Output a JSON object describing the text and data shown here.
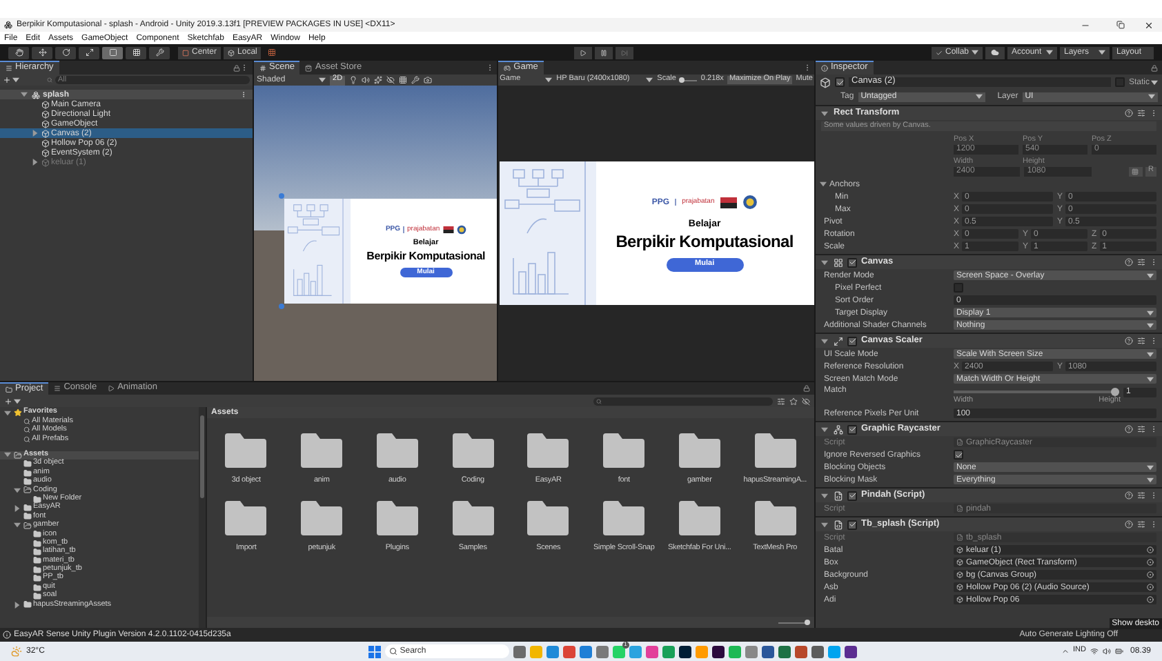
{
  "title_bar": {
    "title": "Berpikir Komputasional - splash - Android - Unity 2019.3.13f1 [PREVIEW PACKAGES IN USE] <DX11>"
  },
  "menu": [
    "File",
    "Edit",
    "Assets",
    "GameObject",
    "Component",
    "Sketchfab",
    "EasyAR",
    "Window",
    "Help"
  ],
  "toolbar": {
    "tools": [
      {
        "kind": "hand",
        "selected": false
      },
      {
        "kind": "move",
        "selected": false
      },
      {
        "kind": "rotate",
        "selected": false
      },
      {
        "kind": "scale",
        "selected": false
      },
      {
        "kind": "rect",
        "selected": true
      },
      {
        "kind": "transform",
        "selected": false
      },
      {
        "kind": "custom",
        "selected": false
      }
    ],
    "pivot": "Center",
    "space": "Local",
    "collab": "Collab",
    "account": "Account",
    "layers": "Layers",
    "layout": "Layout"
  },
  "hierarchy": {
    "title": "Hierarchy",
    "search_placeholder": "All",
    "scene": "splash",
    "items": [
      {
        "label": "Main Camera",
        "selected": false,
        "active": true
      },
      {
        "label": "Directional Light",
        "selected": false,
        "active": true
      },
      {
        "label": "GameObject",
        "selected": false,
        "active": true
      },
      {
        "label": "Canvas (2)",
        "expanded": false,
        "selected": true,
        "active": true
      },
      {
        "label": "Hollow Pop 06 (2)",
        "selected": false,
        "active": true
      },
      {
        "label": "EventSystem (2)",
        "selected": false,
        "active": true
      },
      {
        "label": "keluar (1)",
        "expanded": false,
        "selected": false,
        "active": false
      }
    ]
  },
  "scene_view": {
    "tabs": [
      {
        "label": "Scene",
        "selected": true
      },
      {
        "label": "Asset Store",
        "selected": false
      }
    ],
    "shading": "Shaded",
    "mode_2d": {
      "label": "2D",
      "on": true
    },
    "card": {
      "brand": "PPG",
      "partner": "prajabatan",
      "subtitle": "Belajar",
      "title": "Berpikir Komputasional",
      "button": "Mulai"
    }
  },
  "game_view": {
    "tab": "Game",
    "display": "Game",
    "resolution": "HP Baru (2400x1080)",
    "scale_label": "Scale",
    "scale_slider": {
      "level": 0.1
    },
    "scale": "0.218x",
    "maximize": "Maximize On Play",
    "mute": "Mute",
    "card": {
      "brand": "PPG",
      "partner": "prajabatan",
      "subtitle": "Belajar",
      "title": "Berpikir Komputasional",
      "button": "Mulai"
    }
  },
  "inspector": {
    "title": "Inspector",
    "object": {
      "name": "Canvas (2)",
      "active": true,
      "static": {
        "label": "Static",
        "checked": false
      },
      "tag_label": "Tag",
      "tag": "Untagged",
      "layer_label": "Layer",
      "layer": "UI"
    },
    "rect_transform": {
      "title": "Rect Transform",
      "note": "Some values driven by Canvas.",
      "labels1": [
        "Pos X",
        "Pos Y",
        "Pos Z"
      ],
      "values1": [
        "1200",
        "540",
        "0"
      ],
      "labels2": [
        "Width",
        "Height"
      ],
      "values2": [
        "2400",
        "1080"
      ],
      "raw_button": "R",
      "anchors": {
        "label": "Anchors",
        "expanded": true
      },
      "rows": [
        {
          "kind": "vector",
          "label": "Min",
          "indented": true,
          "cells": [
            {
              "axis": "X",
              "value": "0"
            },
            {
              "axis": "Y",
              "value": "0"
            }
          ]
        },
        {
          "kind": "vector",
          "label": "Max",
          "indented": true,
          "cells": [
            {
              "axis": "X",
              "value": "0"
            },
            {
              "axis": "Y",
              "value": "0"
            }
          ]
        },
        {
          "kind": "vector",
          "label": "Pivot",
          "indented": false,
          "cells": [
            {
              "axis": "X",
              "value": "0.5"
            },
            {
              "axis": "Y",
              "value": "0.5"
            }
          ]
        },
        {
          "kind": "vector",
          "label": "Rotation",
          "indented": false,
          "cells": [
            {
              "axis": "X",
              "value": "0"
            },
            {
              "axis": "Y",
              "value": "0"
            },
            {
              "axis": "Z",
              "value": "0"
            }
          ]
        },
        {
          "kind": "vector",
          "label": "Scale",
          "indented": false,
          "cells": [
            {
              "axis": "X",
              "value": "1"
            },
            {
              "axis": "Y",
              "value": "1"
            },
            {
              "axis": "Z",
              "value": "1"
            }
          ]
        }
      ]
    },
    "components": [
      {
        "title": "Canvas",
        "kind": "canvas",
        "enabled": true,
        "rows": [
          {
            "kind": "dropdown",
            "label": "Render Mode",
            "indented": false,
            "value": "Screen Space - Overlay"
          },
          {
            "kind": "checkbox",
            "label": "Pixel Perfect",
            "indented": true,
            "checked": false
          },
          {
            "kind": "text",
            "label": "Sort Order",
            "indented": true,
            "value": "0"
          },
          {
            "kind": "dropdown",
            "label": "Target Display",
            "indented": true,
            "value": "Display 1"
          },
          {
            "kind": "dropdown",
            "label": "Additional Shader Channels",
            "indented": false,
            "value": "Nothing"
          }
        ]
      },
      {
        "title": "Canvas Scaler",
        "kind": "scaler",
        "enabled": true,
        "rows": [
          {
            "kind": "dropdown",
            "label": "UI Scale Mode",
            "indented": false,
            "value": "Scale With Screen Size"
          },
          {
            "kind": "vector",
            "label": "Reference Resolution",
            "indented": false,
            "cells": [
              {
                "axis": "X",
                "value": "2400"
              },
              {
                "axis": "Y",
                "value": "1080"
              }
            ]
          },
          {
            "kind": "dropdown",
            "label": "Screen Match Mode",
            "indented": false,
            "value": "Match Width Or Height"
          },
          {
            "kind": "slider",
            "label": "Match",
            "indented": false,
            "level": 1,
            "value": "1",
            "min_label": "Width",
            "max_label": "Height"
          },
          {
            "kind": "text",
            "label": "Reference Pixels Per Unit",
            "indented": false,
            "value": "100"
          }
        ]
      },
      {
        "title": "Graphic Raycaster",
        "kind": "raycaster",
        "enabled": true,
        "rows": [
          {
            "kind": "script",
            "label": "Script",
            "indented": false,
            "value": "GraphicRaycaster"
          },
          {
            "kind": "checkbox",
            "label": "Ignore Reversed Graphics",
            "indented": false,
            "checked": true
          },
          {
            "kind": "dropdown",
            "label": "Blocking Objects",
            "indented": false,
            "value": "None"
          },
          {
            "kind": "dropdown",
            "label": "Blocking Mask",
            "indented": false,
            "value": "Everything"
          }
        ]
      },
      {
        "title": "Pindah (Script)",
        "kind": "script",
        "enabled": true,
        "rows": [
          {
            "kind": "script",
            "label": "Script",
            "indented": false,
            "value": "pindah"
          }
        ]
      },
      {
        "title": "Tb_splash (Script)",
        "kind": "script",
        "enabled": true,
        "rows": [
          {
            "kind": "script",
            "label": "Script",
            "indented": false,
            "value": "tb_splash"
          },
          {
            "kind": "object",
            "label": "Batal",
            "indented": false,
            "value": "keluar (1)"
          },
          {
            "kind": "object",
            "label": "Box",
            "indented": false,
            "value": "GameObject (Rect Transform)"
          },
          {
            "kind": "object",
            "label": "Background",
            "indented": false,
            "value": "bg (Canvas Group)"
          },
          {
            "kind": "object",
            "label": "Asb",
            "indented": false,
            "value": "Hollow Pop 06 (2) (Audio Source)"
          },
          {
            "kind": "object",
            "label": "Adi",
            "indented": false,
            "value": "Hollow Pop 06"
          }
        ]
      }
    ]
  },
  "project": {
    "tabs": [
      {
        "label": "Project",
        "selected": true
      },
      {
        "label": "Console",
        "selected": false
      },
      {
        "label": "Animation",
        "selected": false
      }
    ],
    "tree": [
      {
        "label": "Favorites",
        "kind": "favorites",
        "expanded": true,
        "selected": false,
        "children": [
          {
            "label": "All Materials",
            "kind": "search",
            "selected": false
          },
          {
            "label": "All Models",
            "kind": "search",
            "selected": false
          },
          {
            "label": "All Prefabs",
            "kind": "search",
            "selected": false
          }
        ]
      },
      {
        "label": "Assets",
        "kind": "folder",
        "expanded": true,
        "selected": true,
        "children": [
          {
            "label": "3d object",
            "kind": "folder",
            "selected": false
          },
          {
            "label": "anim",
            "kind": "folder",
            "selected": false
          },
          {
            "label": "audio",
            "kind": "folder",
            "selected": false
          },
          {
            "label": "Coding",
            "kind": "folder",
            "expanded": true,
            "selected": false,
            "children": [
              {
                "label": "New Folder",
                "kind": "folder",
                "selected": false
              }
            ]
          },
          {
            "label": "EasyAR",
            "kind": "folder",
            "expanded": false,
            "selected": false
          },
          {
            "label": "font",
            "kind": "folder",
            "selected": false
          },
          {
            "label": "gamber",
            "kind": "folder",
            "expanded": true,
            "selected": false,
            "children": [
              {
                "label": "icon",
                "kind": "folder",
                "selected": false
              },
              {
                "label": "kom_tb",
                "kind": "folder",
                "selected": false
              },
              {
                "label": "latihan_tb",
                "kind": "folder",
                "selected": false
              },
              {
                "label": "materi_tb",
                "kind": "folder",
                "selected": false
              },
              {
                "label": "petunjuk_tb",
                "kind": "folder",
                "selected": false
              },
              {
                "label": "PP_tb",
                "kind": "folder",
                "selected": false
              },
              {
                "label": "quit",
                "kind": "folder",
                "selected": false
              },
              {
                "label": "soal",
                "kind": "folder",
                "selected": false
              }
            ]
          },
          {
            "label": "hapusStreamingAssets",
            "kind": "folder",
            "expanded": false,
            "selected": false
          }
        ]
      }
    ],
    "breadcrumb": "Assets",
    "assets": [
      "3d object",
      "anim",
      "audio",
      "Coding",
      "EasyAR",
      "font",
      "gamber",
      "hapusStreamingA...",
      "Import",
      "petunjuk",
      "Plugins",
      "Samples",
      "Scenes",
      "Simple Scroll-Snap",
      "Sketchfab For Uni...",
      "TextMesh Pro"
    ],
    "icon_size": {
      "level": 0.95
    }
  },
  "status_bar": {
    "message": "EasyAR Sense Unity Plugin Version 4.2.0.1102-0415d235a",
    "lighting": "Auto Generate Lighting Off",
    "tooltip": "Show deskto"
  },
  "taskbar": {
    "weather": "32°C",
    "search": "Search",
    "app_badge": "1",
    "language": "IND",
    "time": "08.39"
  }
}
